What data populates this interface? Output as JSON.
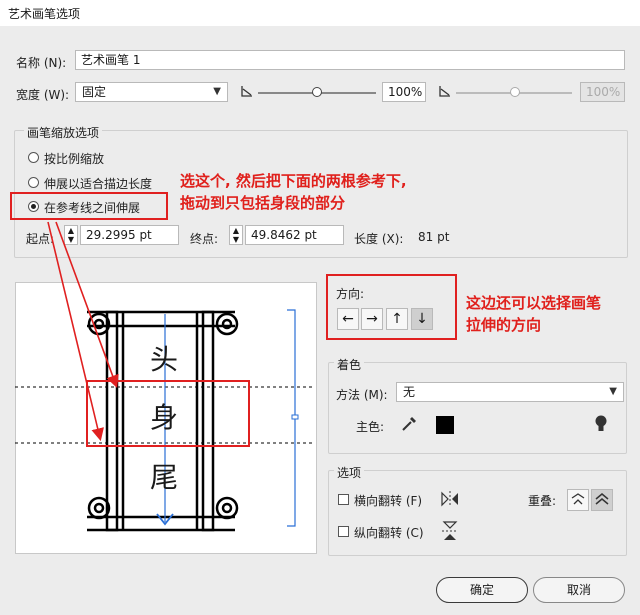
{
  "window": {
    "title": "艺术画笔选项"
  },
  "name": {
    "label": "名称 (N):",
    "value": "艺术画笔 1"
  },
  "width": {
    "label": "宽度 (W):",
    "select": "固定",
    "percent1": "100%",
    "percent2": "100%"
  },
  "scale": {
    "group_title": "画笔缩放选项",
    "options": [
      "按比例缩放",
      "伸展以适合描边长度",
      "在参考线之间伸展"
    ],
    "selected_index": 2,
    "start_label": "起点:",
    "start_value": "29.2995 pt",
    "end_label": "终点:",
    "end_value": "49.8462 pt",
    "length_label": "长度 (X):",
    "length_value": "81 pt"
  },
  "annotations": {
    "line1": "选这个, 然后把下面的两根参考下,",
    "line2": "拖动到只包括身段的部分",
    "dir_line1": "这边还可以选择画笔",
    "dir_line2": "拉伸的方向"
  },
  "preview": {
    "top": "头",
    "mid": "身",
    "bottom": "尾"
  },
  "direction": {
    "title": "方向:",
    "buttons": [
      "←",
      "→",
      "↑",
      "↓"
    ],
    "selected_index": 3
  },
  "colorize": {
    "group_title": "着色",
    "method_label": "方法 (M):",
    "method_value": "无",
    "key_label": "主色:"
  },
  "options": {
    "group_title": "选项",
    "flip_h": "横向翻转 (F)",
    "flip_v": "纵向翻转 (C)",
    "overlap_label": "重叠:"
  },
  "buttons": {
    "ok": "确定",
    "cancel": "取消"
  },
  "colors": {
    "annotation": "#e0201c",
    "guide_blue": "#2a6fd6"
  }
}
